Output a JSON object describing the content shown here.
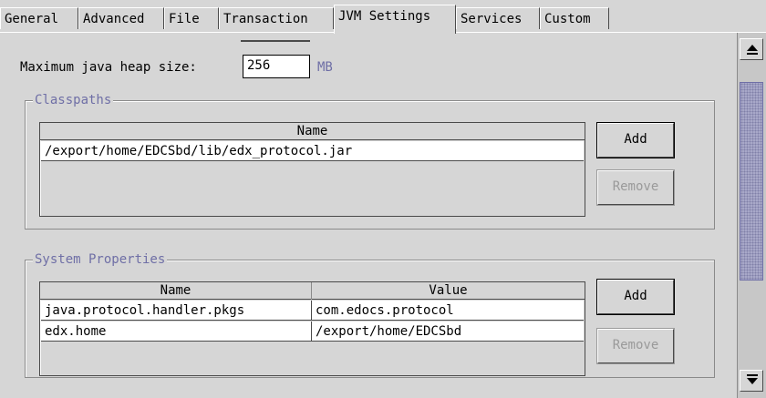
{
  "tabs": [
    {
      "label": "General"
    },
    {
      "label": "Advanced"
    },
    {
      "label": "File"
    },
    {
      "label": "Transaction"
    },
    {
      "label": "JVM Settings",
      "active": true
    },
    {
      "label": "Services"
    },
    {
      "label": "Custom"
    }
  ],
  "heap": {
    "label": "Maximum java heap size:",
    "value": "256",
    "unit": "MB"
  },
  "classpaths": {
    "legend": "Classpaths",
    "header": "Name",
    "rows": [
      "/export/home/EDCSbd/lib/edx_protocol.jar"
    ],
    "add_label": "Add",
    "remove_label": "Remove"
  },
  "system_properties": {
    "legend": "System Properties",
    "headers": [
      "Name",
      "Value"
    ],
    "rows": [
      {
        "name": "java.protocol.handler.pkgs",
        "value": "com.edocs.protocol"
      },
      {
        "name": "edx.home",
        "value": "/export/home/EDCSbd"
      }
    ],
    "add_label": "Add",
    "remove_label": "Remove"
  },
  "colors": {
    "background": "#d6d6d6",
    "legend_text": "#6f6fa6",
    "scroll_thumb": "#a8a8c8"
  }
}
